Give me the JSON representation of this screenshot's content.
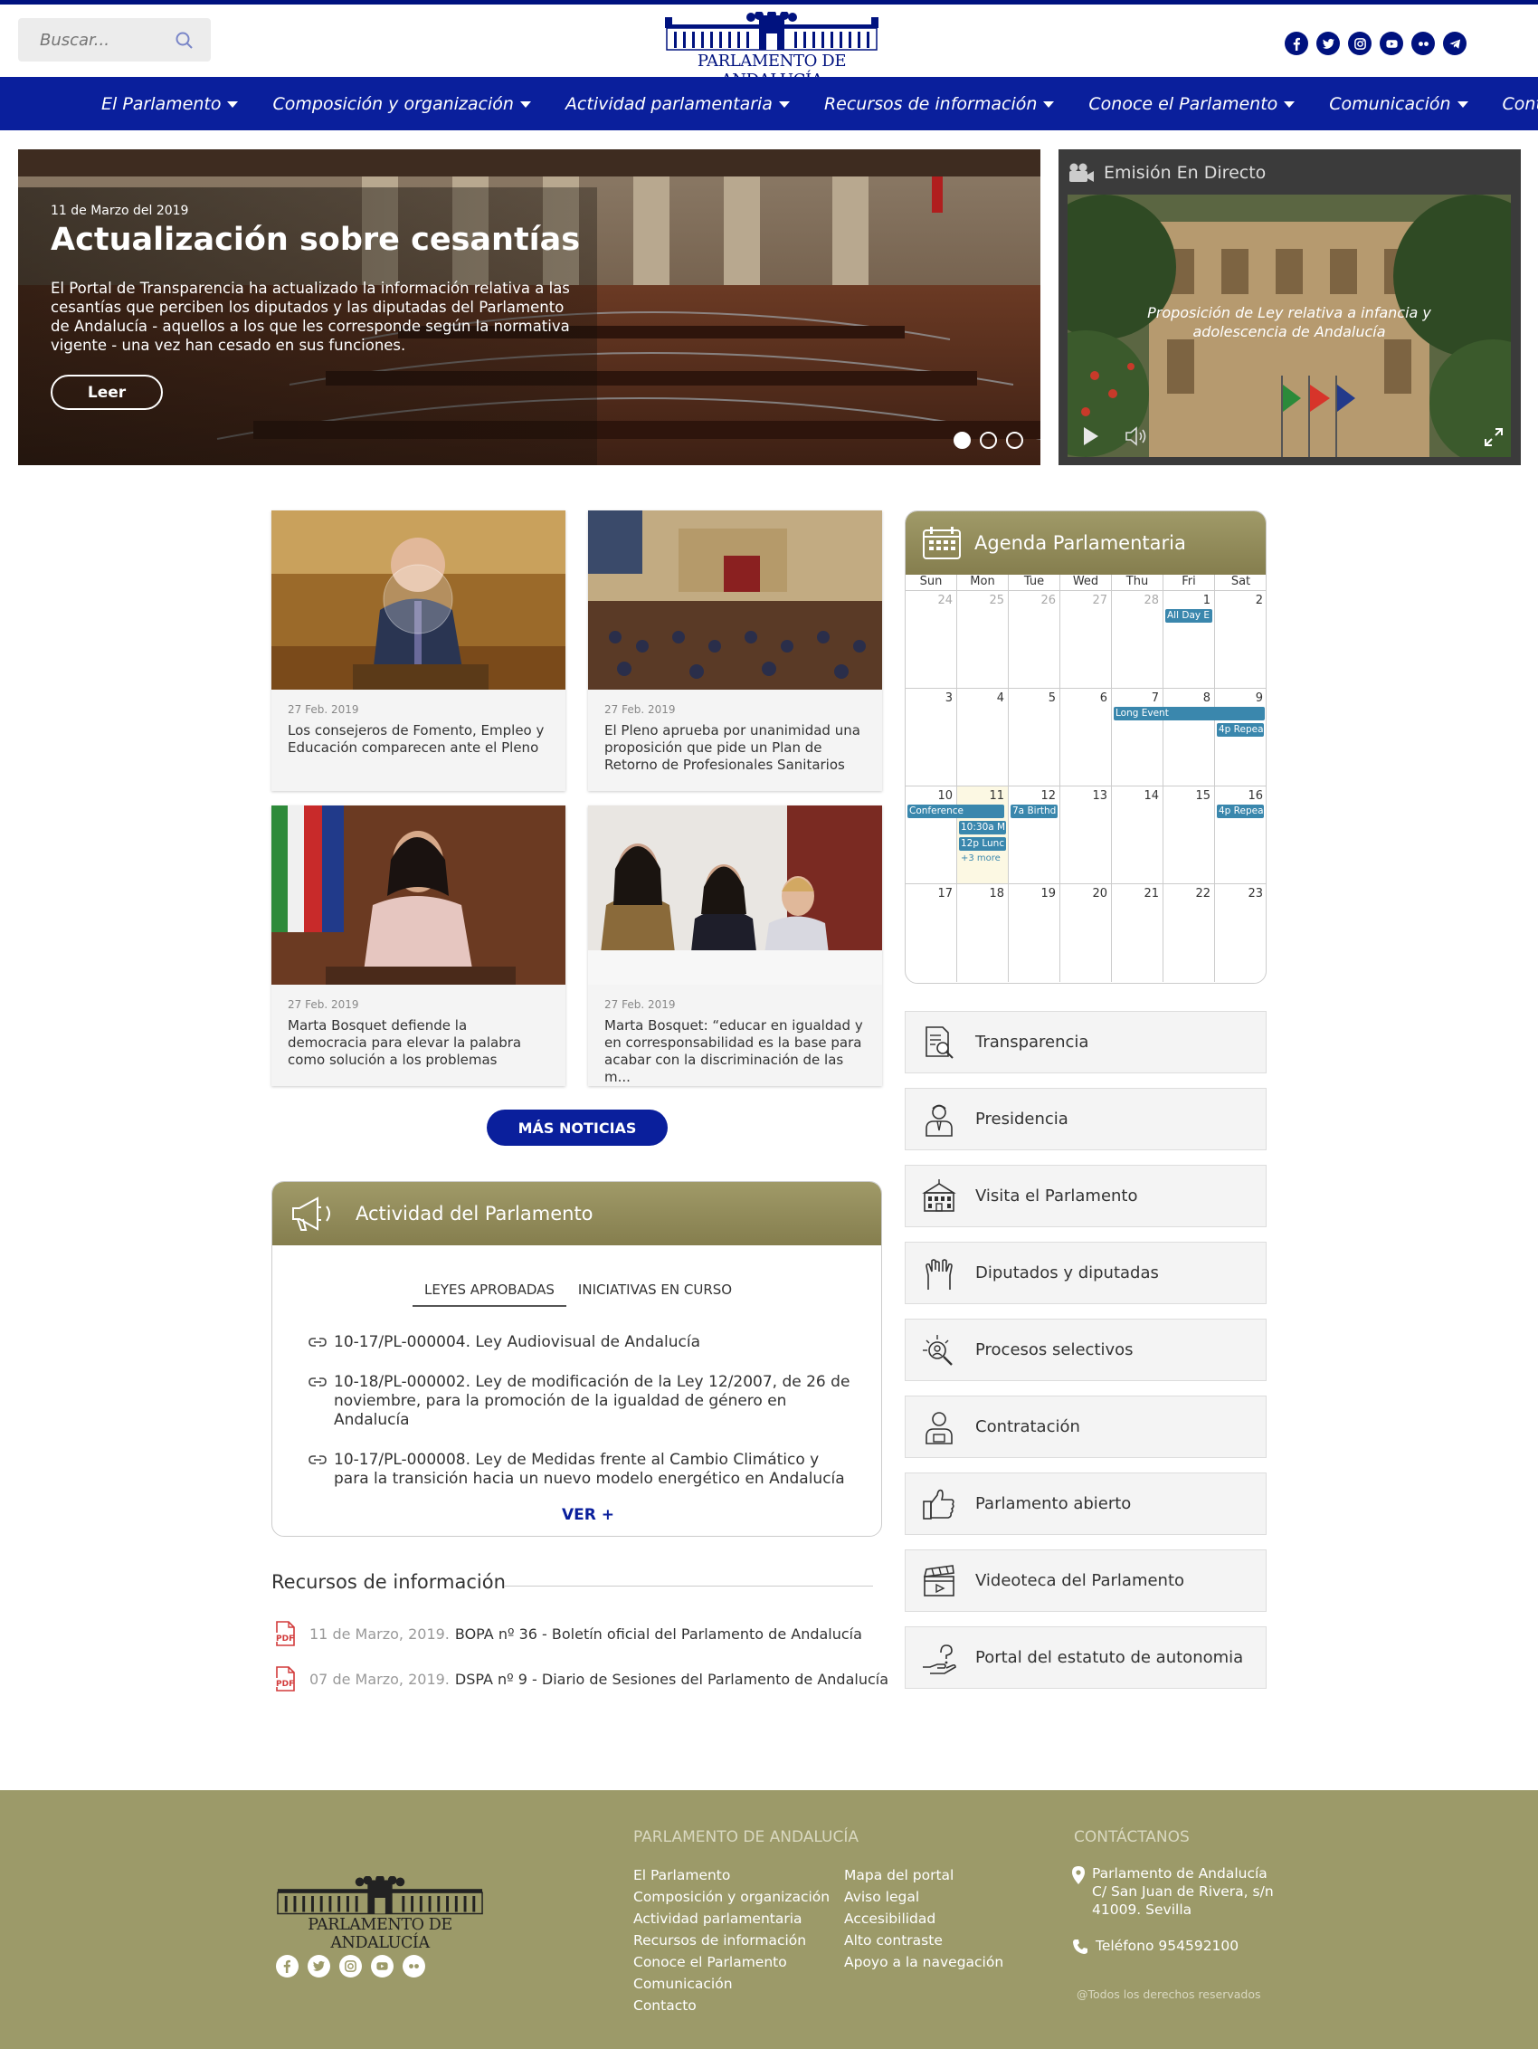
{
  "search": {
    "placeholder": "Buscar..."
  },
  "logo": {
    "text": "PARLAMENTO DE ANDALUCÍA"
  },
  "socials": [
    "facebook-icon",
    "twitter-icon",
    "instagram-icon",
    "youtube-icon",
    "flickr-icon",
    "telegram-icon"
  ],
  "nav": {
    "items": [
      {
        "label": "El Parlamento",
        "dropdown": true
      },
      {
        "label": "Composición y organización",
        "dropdown": true
      },
      {
        "label": "Actividad parlamentaria",
        "dropdown": true
      },
      {
        "label": "Recursos de información",
        "dropdown": true
      },
      {
        "label": "Conoce el Parlamento",
        "dropdown": true
      },
      {
        "label": "Comunicación",
        "dropdown": true
      },
      {
        "label": "Contacto",
        "dropdown": false
      }
    ]
  },
  "hero": {
    "date": "11 de Marzo del 2019",
    "title": "Actualización sobre cesantías",
    "text": "El Portal de Transparencia ha actualizado la información relativa a las cesantías que perciben los diputados y las diputadas del Parlamento de Andalucía - aquellos a los que les corresponde según la normativa vigente - una vez han cesado en sus funciones.",
    "button": "Leer",
    "slides": 3,
    "active_slide": 1
  },
  "live": {
    "title": "Emisión En Directo",
    "caption": "Proposición de Ley relativa a infancia y adolescencia de Andalucía"
  },
  "news": [
    {
      "date": "27 Feb. 2019",
      "title": "Los consejeros de Fomento, Empleo y Educación comparecen ante el Pleno"
    },
    {
      "date": "27 Feb. 2019",
      "title": "El Pleno aprueba por unanimidad una proposición que pide un Plan de Retorno de Profesionales Sanitarios"
    },
    {
      "date": "27 Feb. 2019",
      "title": "Marta Bosquet defiende la democracia para elevar la palabra como solución a los problemas"
    },
    {
      "date": "27 Feb. 2019",
      "title": "Marta Bosquet: “educar en igualdad y en corresponsabilidad es la base para acabar con la discriminación de las m..."
    }
  ],
  "more_news": "MÁS NOTICIAS",
  "agenda": {
    "title": "Agenda Parlamentaria",
    "weekdays": [
      "Sun",
      "Mon",
      "Tue",
      "Wed",
      "Thu",
      "Fri",
      "Sat"
    ],
    "weeks": [
      [
        "24",
        "25",
        "26",
        "27",
        "28",
        "1",
        "2"
      ],
      [
        "3",
        "4",
        "5",
        "6",
        "7",
        "8",
        "9"
      ],
      [
        "10",
        "11",
        "12",
        "13",
        "14",
        "15",
        "16"
      ],
      [
        "17",
        "18",
        "19",
        "20",
        "21",
        "22",
        "23"
      ]
    ],
    "events": {
      "all_day": "All Day E",
      "long_event": "Long Event",
      "repeat1": "4p Repea",
      "conference": "Conference",
      "birthday": "7a Birthd",
      "meeting": "10:30a M",
      "lunch": "12p Lunc",
      "more": "+3 more",
      "repeat2": "4p Repea"
    }
  },
  "quicklinks": [
    {
      "label": "Transparencia",
      "icon": "transparency-icon"
    },
    {
      "label": "Presidencia",
      "icon": "president-icon"
    },
    {
      "label": "Visita el Parlamento",
      "icon": "building-icon"
    },
    {
      "label": "Diputados y diputadas",
      "icon": "hands-icon"
    },
    {
      "label": "Procesos selectivos",
      "icon": "selection-icon"
    },
    {
      "label": "Contratación",
      "icon": "contract-person-icon"
    },
    {
      "label": "Parlamento abierto",
      "icon": "thumbs-up-icon"
    },
    {
      "label": "Videoteca del Parlamento",
      "icon": "clapperboard-icon"
    },
    {
      "label": "Portal del estatuto de autonomia",
      "icon": "help-hand-icon"
    }
  ],
  "actividad": {
    "title": "Actividad del Parlamento",
    "tabs": [
      "LEYES APROBADAS",
      "INICIATIVAS EN CURSO"
    ],
    "items": [
      "10-17/PL-000004. Ley Audiovisual de Andalucía",
      "10-18/PL-000002. Ley de modificación de la Ley 12/2007, de 26 de noviembre, para la promoción de la igualdad de género en Andalucía",
      "10-17/PL-000008. Ley de Medidas frente al Cambio Climático y para la transición hacia un nuevo modelo energético en Andalucía"
    ],
    "more": "VER +"
  },
  "recursos": {
    "title": "Recursos de información",
    "items": [
      {
        "date": "11 de Marzo, 2019.",
        "text": "BOPA nº 36 - Boletín oficial del Parlamento de Andalucía"
      },
      {
        "date": "07 de Marzo, 2019.",
        "text": "DSPA nº 9 - Diario de Sesiones del Parlamento de Andalucía"
      }
    ]
  },
  "footer": {
    "logo_text": "PARLAMENTO DE ANDALUCÍA",
    "section_title": "PARLAMENTO DE ANDALUCÍA",
    "col1": [
      "El Parlamento",
      "Composición y organización",
      "Actividad parlamentaria",
      "Recursos de información",
      "Conoce el Parlamento",
      "Comunicación",
      "Contacto"
    ],
    "col2": [
      "Mapa del portal",
      "Aviso legal",
      "Accesibilidad",
      "Alto contraste",
      "Apoyo a la navegación"
    ],
    "contact_title": "CONTÁCTANOS",
    "address": [
      "Parlamento de Andalucía",
      "C/ San Juan de Rivera, s/n",
      "41009. Sevilla"
    ],
    "phone": "Teléfono 954592100",
    "rights": "@Todos los derechos reservados"
  },
  "colors": {
    "primary": "#0a1f9c",
    "olive": "#9c9a69",
    "event": "#3a87ad"
  }
}
